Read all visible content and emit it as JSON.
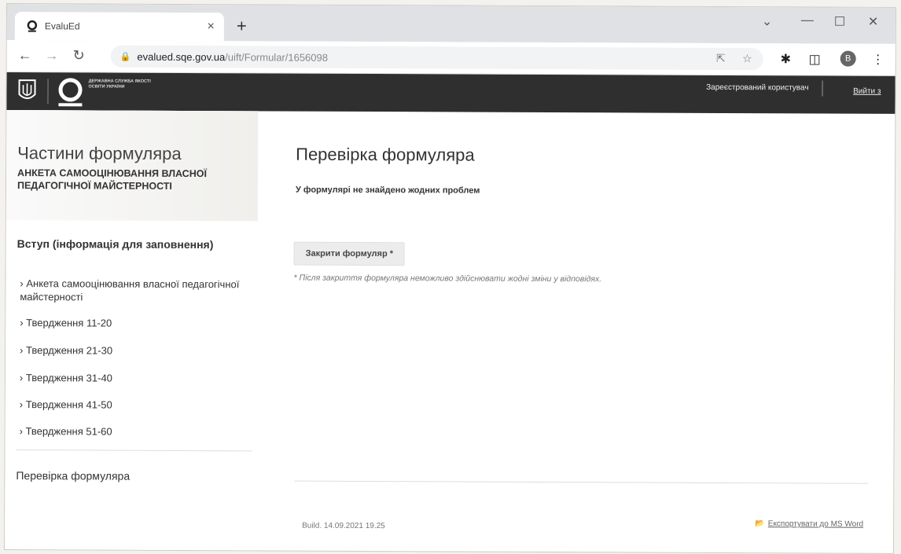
{
  "browser": {
    "tab_title": "EvaluEd",
    "tab_close": "×",
    "new_tab": "+",
    "url_domain": "evalued.sqe.gov.ua",
    "url_path": "/uift/Formular/1656098",
    "profile_initial": "B"
  },
  "header": {
    "logo_text": "ДЕРЖАВНА СЛУЖБА ЯКОСТІ ОСВІТИ УКРАЇНИ",
    "user_label": "Зареєстрований користувач",
    "logout": "Вийти з"
  },
  "sidebar": {
    "title": "Частини формуляра",
    "subtitle": "АНКЕТА САМООЦІНЮВАННЯ ВЛАСНОЇ ПЕДАГОГІЧНОЇ МАЙСТЕРНОСТІ",
    "intro": "Вступ (інформація для заповнення)",
    "items": [
      "› Анкета самооцінювання власної педагогічної майстерності",
      "› Твердження 11-20",
      "› Твердження 21-30",
      "› Твердження 31-40",
      "› Твердження 41-50",
      "› Твердження 51-60"
    ],
    "check": "Перевірка формуляра"
  },
  "main": {
    "title": "Перевірка формуляра",
    "message": "У формулярі не знайдено жодних проблем",
    "close_button": "Закрити формуляр *",
    "note": "* Після закриття формуляра неможливо здійснювати жодні зміни у відповідях.",
    "build": "Build. 14.09.2021 19.25",
    "export": "Експортувати до MS Word"
  }
}
